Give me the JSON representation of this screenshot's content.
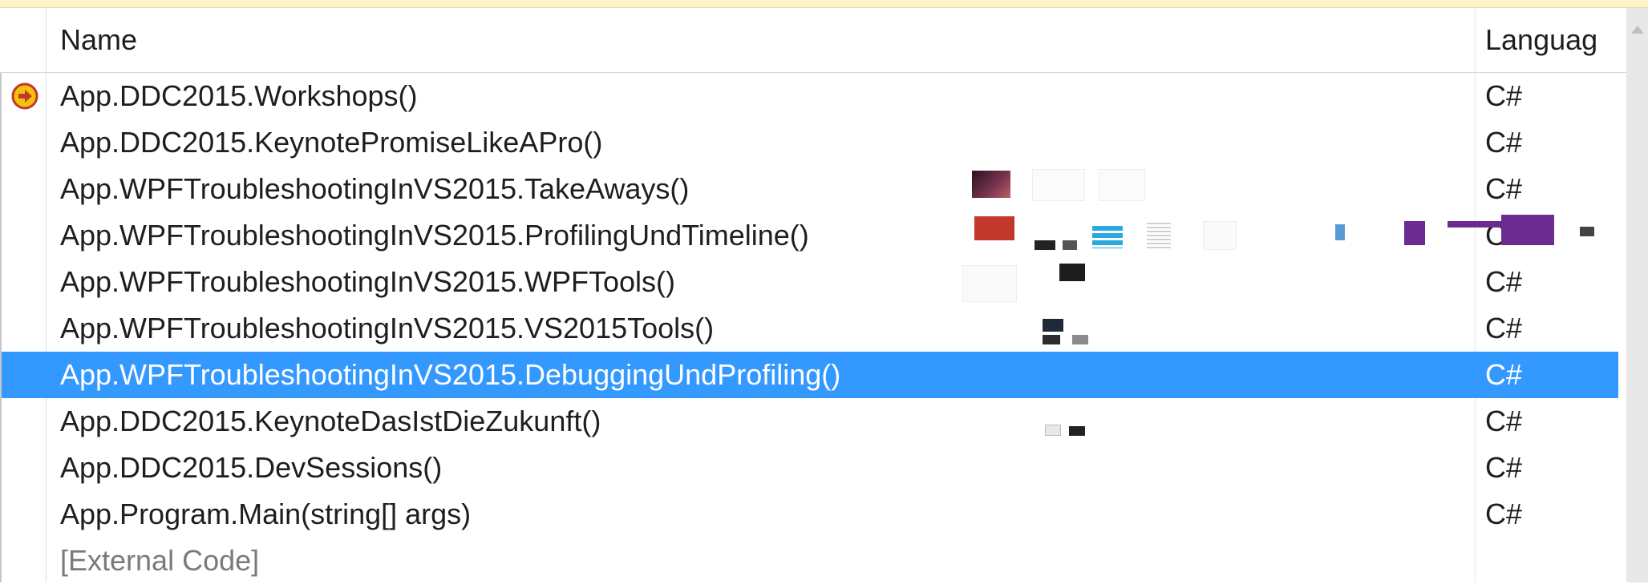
{
  "columns": {
    "name": "Name",
    "language": "Languag"
  },
  "rows": [
    {
      "name": "App.DDC2015.Workshops()",
      "language": "C#",
      "current": true
    },
    {
      "name": "App.DDC2015.KeynotePromiseLikeAPro()",
      "language": "C#"
    },
    {
      "name": "App.WPFTroubleshootingInVS2015.TakeAways()",
      "language": "C#"
    },
    {
      "name": "App.WPFTroubleshootingInVS2015.ProfilingUndTimeline()",
      "language": "C#"
    },
    {
      "name": "App.WPFTroubleshootingInVS2015.WPFTools()",
      "language": "C#"
    },
    {
      "name": "App.WPFTroubleshootingInVS2015.VS2015Tools()",
      "language": "C#"
    },
    {
      "name": "App.WPFTroubleshootingInVS2015.DebuggingUndProfiling()",
      "language": "C#",
      "selected": true
    },
    {
      "name": "App.DDC2015.KeynoteDasIstDieZukunft()",
      "language": "C#"
    },
    {
      "name": "App.DDC2015.DevSessions()",
      "language": "C#"
    },
    {
      "name": "App.Program.Main(string[] args)",
      "language": "C#"
    },
    {
      "name": "[External Code]",
      "language": "",
      "external": true
    }
  ],
  "icons": {
    "current_frame": "current-frame-arrow-icon",
    "scroll_up": "scroll-up-arrow-icon"
  },
  "colors": {
    "selection": "#3399ff",
    "current_frame_fill": "#f4c20d",
    "current_frame_ring": "#c0392b",
    "top_strip": "#fdf5c6",
    "purple_slide": "#6a2c91"
  }
}
